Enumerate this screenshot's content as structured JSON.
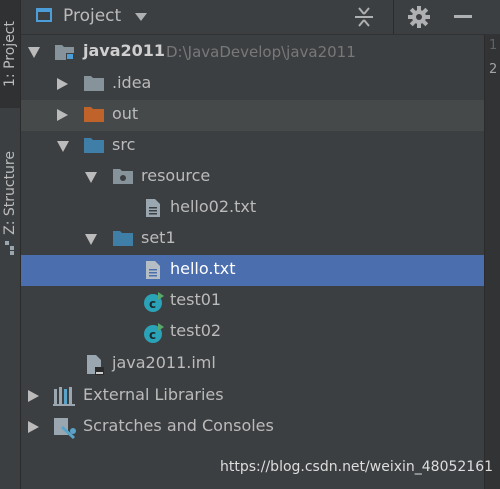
{
  "tool_window": {
    "side_tabs": [
      {
        "label": "1: Project"
      },
      {
        "label": "Z: Structure"
      }
    ],
    "title": "Project",
    "gutter_numbers": [
      "1",
      "2"
    ]
  },
  "tree": {
    "root": {
      "label": "java2011",
      "path": "D:\\JavaDevelop\\java2011"
    },
    "items": [
      {
        "label": ".idea"
      },
      {
        "label": "out"
      },
      {
        "label": "src"
      },
      {
        "label": "resource"
      },
      {
        "label": "hello02.txt"
      },
      {
        "label": "set1"
      },
      {
        "label": "hello.txt"
      },
      {
        "label": "test01"
      },
      {
        "label": "test02"
      },
      {
        "label": "java2011.iml"
      },
      {
        "label": "External Libraries"
      },
      {
        "label": "Scratches and Consoles"
      }
    ]
  },
  "watermark": "https://blog.csdn.net/weixin_48052161",
  "colors": {
    "background": "#3c3f41",
    "selection": "#4b6eaf",
    "folder_blue": "#3f7ea6",
    "folder_orange": "#c0632b",
    "folder_gray": "#87939a",
    "class_teal": "#2aa3b8",
    "run_green": "#59a869"
  }
}
